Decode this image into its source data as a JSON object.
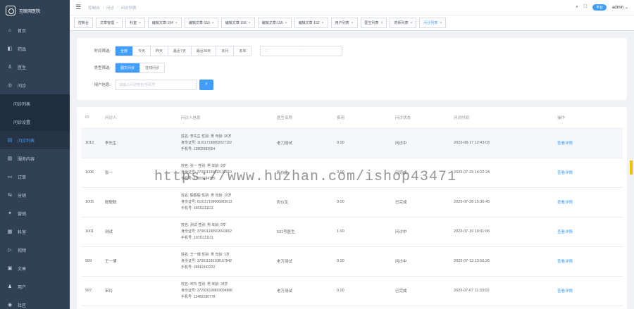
{
  "app": {
    "name": "互联网医院"
  },
  "sidebar": {
    "items": [
      {
        "label": "首页",
        "icon": "home-icon"
      },
      {
        "label": "药品",
        "icon": "pill-icon"
      },
      {
        "label": "医生",
        "icon": "doctor-icon"
      },
      {
        "label": "问诊",
        "icon": "consult-icon"
      }
    ],
    "submenu": [
      {
        "label": "问诊列表"
      },
      {
        "label": "问诊设置"
      }
    ],
    "items2": [
      {
        "label": "问诊列表",
        "icon": "list-icon",
        "active": true
      },
      {
        "label": "服务内容",
        "icon": "service-icon"
      },
      {
        "label": "订单",
        "icon": "order-icon"
      },
      {
        "label": "分销",
        "icon": "share-icon"
      },
      {
        "label": "营销",
        "icon": "marketing-icon"
      },
      {
        "label": "科室",
        "icon": "dept-icon"
      },
      {
        "label": "视频",
        "icon": "video-icon"
      },
      {
        "label": "文章",
        "icon": "article-icon"
      },
      {
        "label": "用户",
        "icon": "user-icon"
      },
      {
        "label": "社区",
        "icon": "community-icon"
      }
    ]
  },
  "navbar": {
    "breadcrumb": [
      "控制台",
      "问诊",
      "问诊列表"
    ],
    "badge": "平台",
    "user": "admin"
  },
  "tags": [
    {
      "label": "控制台",
      "closable": false
    },
    {
      "label": "文章管理",
      "closable": true
    },
    {
      "label": "科室",
      "closable": true
    },
    {
      "label": "编辑文章-154",
      "closable": true
    },
    {
      "label": "编辑文章-153",
      "closable": true
    },
    {
      "label": "编辑文章-156",
      "closable": true
    },
    {
      "label": "编辑文章-155",
      "closable": true
    },
    {
      "label": "编辑文章-152",
      "closable": true
    },
    {
      "label": "用户列表",
      "closable": true
    },
    {
      "label": "医生列表",
      "closable": true
    },
    {
      "label": "药师列表",
      "closable": true
    },
    {
      "label": "问诊列表",
      "closable": true,
      "active": true
    }
  ],
  "filters": {
    "time_label": "时间筛选:",
    "time_options": [
      "全部",
      "今天",
      "昨天",
      "最近7天",
      "最近30天",
      "本月",
      "本年"
    ],
    "time_selected": 0,
    "date_dash": "-",
    "type_label": "类型筛选:",
    "type_options": [
      "图文问诊",
      "在线问诊"
    ],
    "type_selected": 0,
    "user_label": "用户信息:",
    "user_placeholder": "请输入问诊姓名/手机号"
  },
  "table": {
    "columns": [
      "ID",
      "问诊人",
      "问诊人信息",
      "医生名称",
      "费用",
      "问诊状态",
      "问诊时间",
      "操作"
    ],
    "rows": [
      {
        "id": "1012",
        "name": "李先生",
        "info": [
          "姓名: 李先生 性别: 男 年龄: 30岁",
          "身份证号: 110117198802027122",
          "手机号: 13802983054"
        ],
        "doctor": "老刀测试",
        "fee": "0.00",
        "status": "问诊中",
        "time": "2023-08-17 12:43:03",
        "op": "查看详情"
      },
      {
        "id": "1006",
        "name": "张一",
        "info": [
          "姓名: 张一 性别: 男 年龄: 9岁",
          "身份证号: 370911199912132019",
          "手机号: 13683684795"
        ],
        "doctor": "彩仪生",
        "fee": "0.00",
        "status": "已完成",
        "time": "2023-07-29 14:22:24",
        "op": "查看详情"
      },
      {
        "id": "1005",
        "name": "聪聪聪",
        "info": [
          "姓名: 聪聪聪 性别: 男 年龄: 10岁",
          "身份证号: 610117199906083613",
          "手机号: 15611111111"
        ],
        "doctor": "彩仪生",
        "fee": "0.00",
        "status": "已完成",
        "time": "2023-07-28 15:36:45",
        "op": "查看详情"
      },
      {
        "id": "1001",
        "name": "测试",
        "info": [
          "姓名: 测试 性别: 男 年龄: 9岁",
          "身份证号: 370811198902043652",
          "手机号: 13011111111"
        ],
        "doctor": "531号医生",
        "fee": "1.00",
        "status": "问诊中",
        "time": "2023-07-19 19:01:06",
        "op": "查看详情"
      },
      {
        "id": "999",
        "name": "王一博",
        "info": [
          "姓名: 王一博 性别: 男 年龄: 1岁",
          "身份证号: 370911199108167842",
          "手机号: 18812342222"
        ],
        "doctor": "老万测试",
        "fee": "0.00",
        "status": "问诊中",
        "time": "2023-07-13 13:56:26",
        "op": "查看详情"
      },
      {
        "id": "997",
        "name": "宋玲",
        "info": [
          "姓名: 宋玲 性别: 男 年龄: 34岁",
          "身份证号: 372926198803094888",
          "手机号: 13482280778"
        ],
        "doctor": "老万测试",
        "fee": "0.00",
        "status": "已完成",
        "time": "2023-07-07 11:33:02",
        "op": "查看详情"
      }
    ]
  },
  "watermark": "https://www.huzhan.com/ishop43471"
}
